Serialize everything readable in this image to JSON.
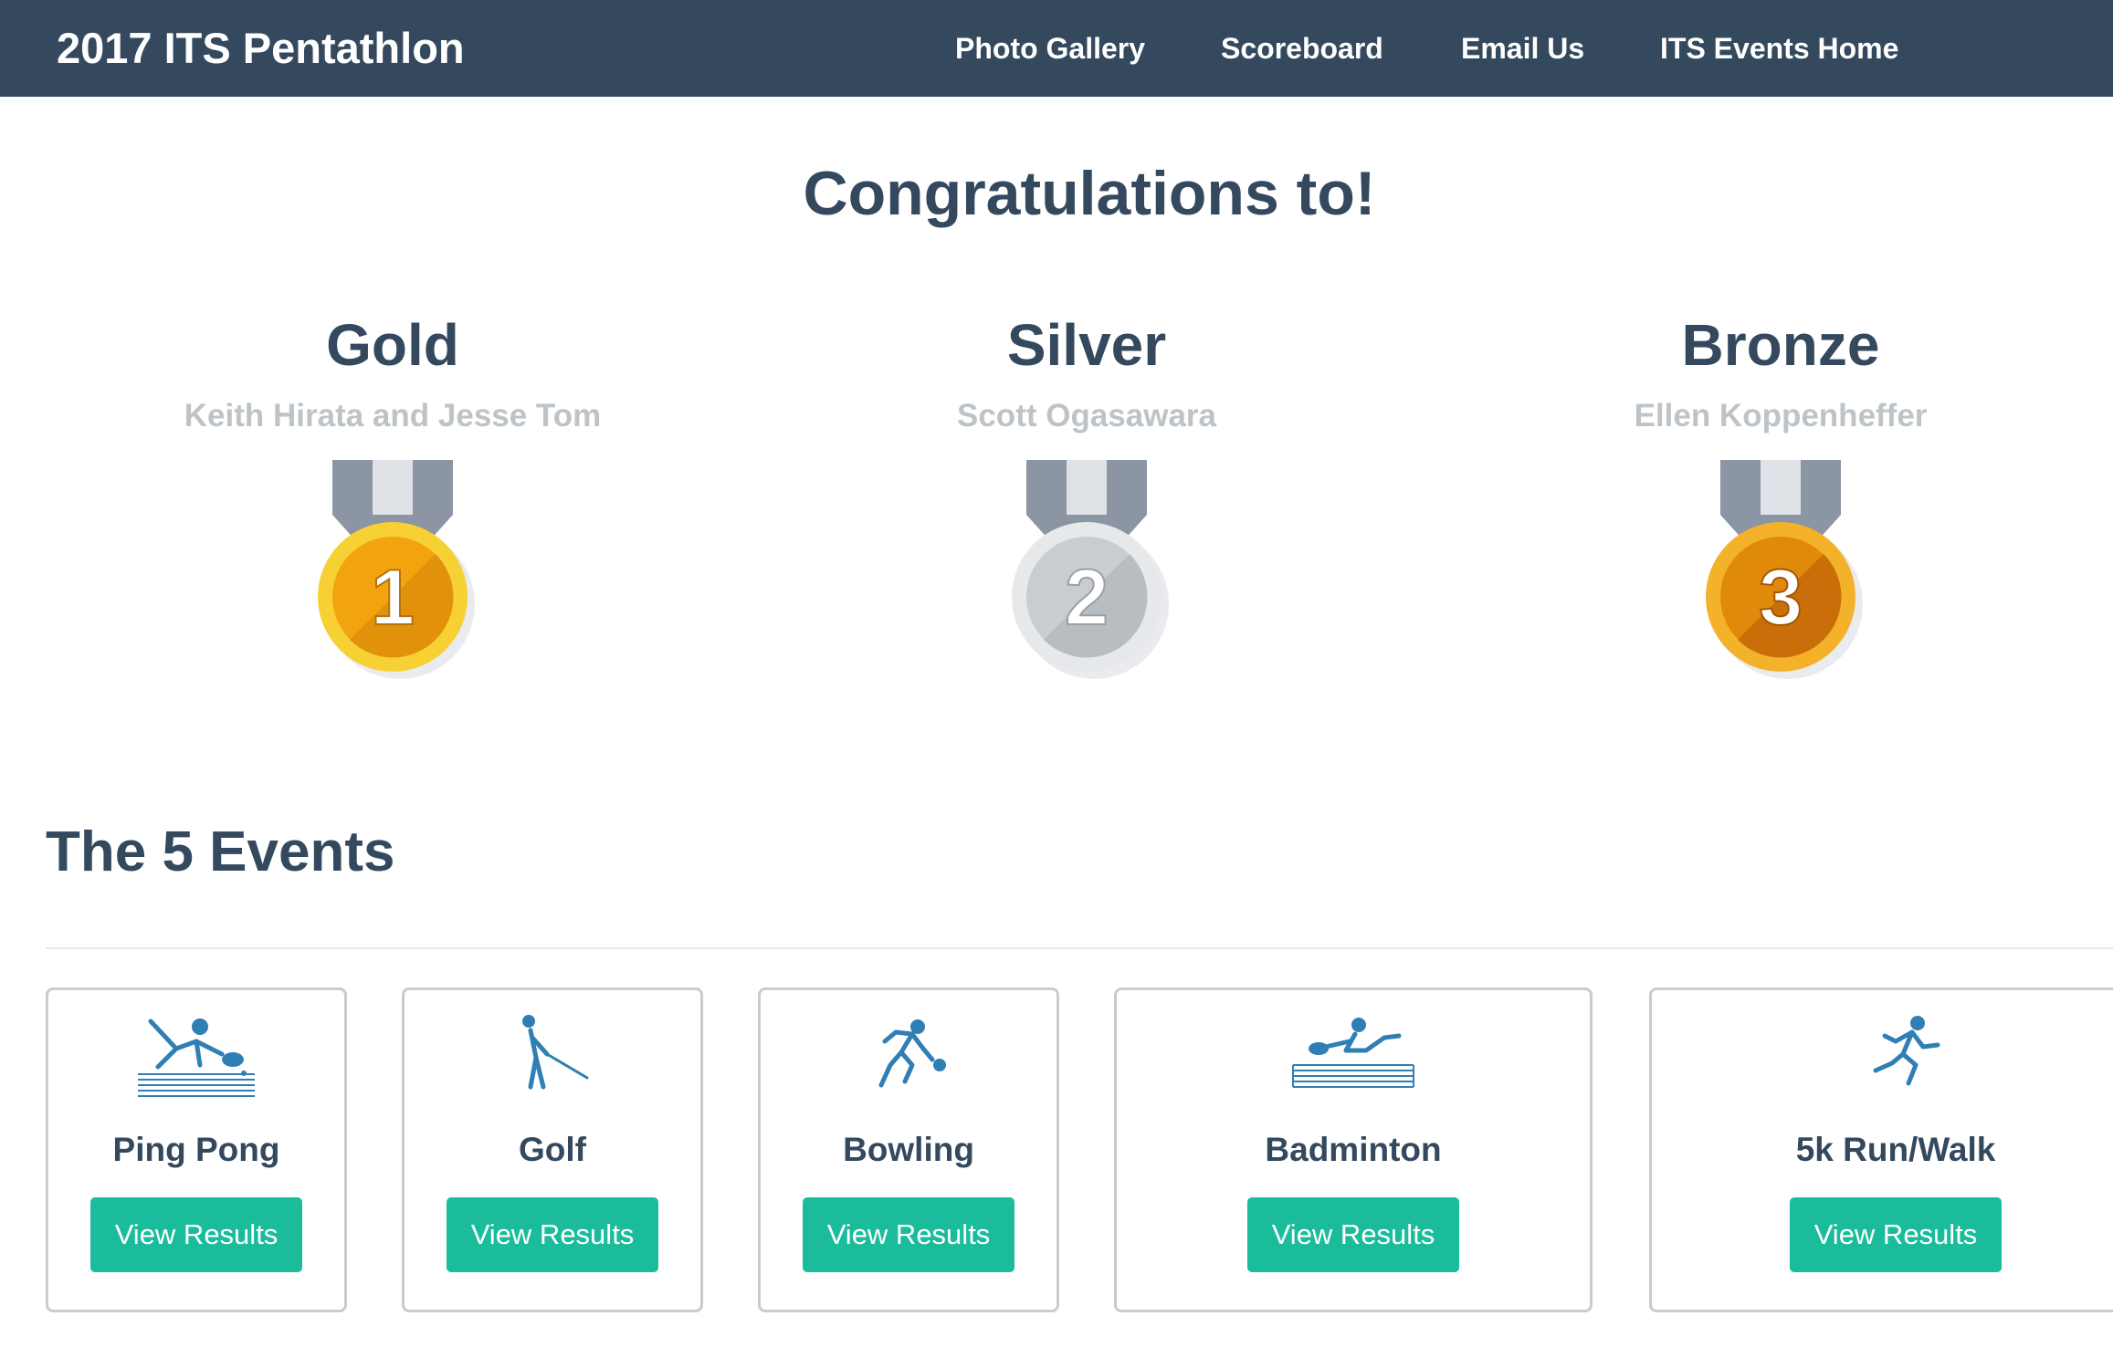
{
  "navbar": {
    "brand": "2017 ITS Pentathlon",
    "links": [
      {
        "label": "Photo Gallery"
      },
      {
        "label": "Scoreboard"
      },
      {
        "label": "Email Us"
      },
      {
        "label": "ITS Events Home"
      }
    ],
    "background": "#34495e"
  },
  "congrats": {
    "title": "Congratulations to!"
  },
  "medals": [
    {
      "place": "Gold",
      "winner": "Keith Hirata and Jesse Tom",
      "number": "1",
      "icon": "gold-medal-icon",
      "color": "#f5a70f"
    },
    {
      "place": "Silver",
      "winner": "Scott Ogasawara",
      "number": "2",
      "icon": "silver-medal-icon",
      "color": "#c9cdd1"
    },
    {
      "place": "Bronze",
      "winner": "Ellen Koppenheffer",
      "number": "3",
      "icon": "bronze-medal-icon",
      "color": "#e08a0c"
    }
  ],
  "events_section": {
    "title": "The 5 Events"
  },
  "events": [
    {
      "name": "Ping Pong",
      "icon": "ping-pong-icon",
      "button": "View Results"
    },
    {
      "name": "Golf",
      "icon": "golf-icon",
      "button": "View Results"
    },
    {
      "name": "Bowling",
      "icon": "bowling-icon",
      "button": "View Results"
    },
    {
      "name": "Badminton",
      "icon": "badminton-icon",
      "button": "View Results"
    },
    {
      "name": "5k Run/Walk",
      "icon": "running-icon",
      "button": "View Results"
    }
  ],
  "colors": {
    "primary_text": "#34495e",
    "muted_text": "#bdc3c7",
    "button": "#1abc9c",
    "icon": "#2f7fb5"
  }
}
